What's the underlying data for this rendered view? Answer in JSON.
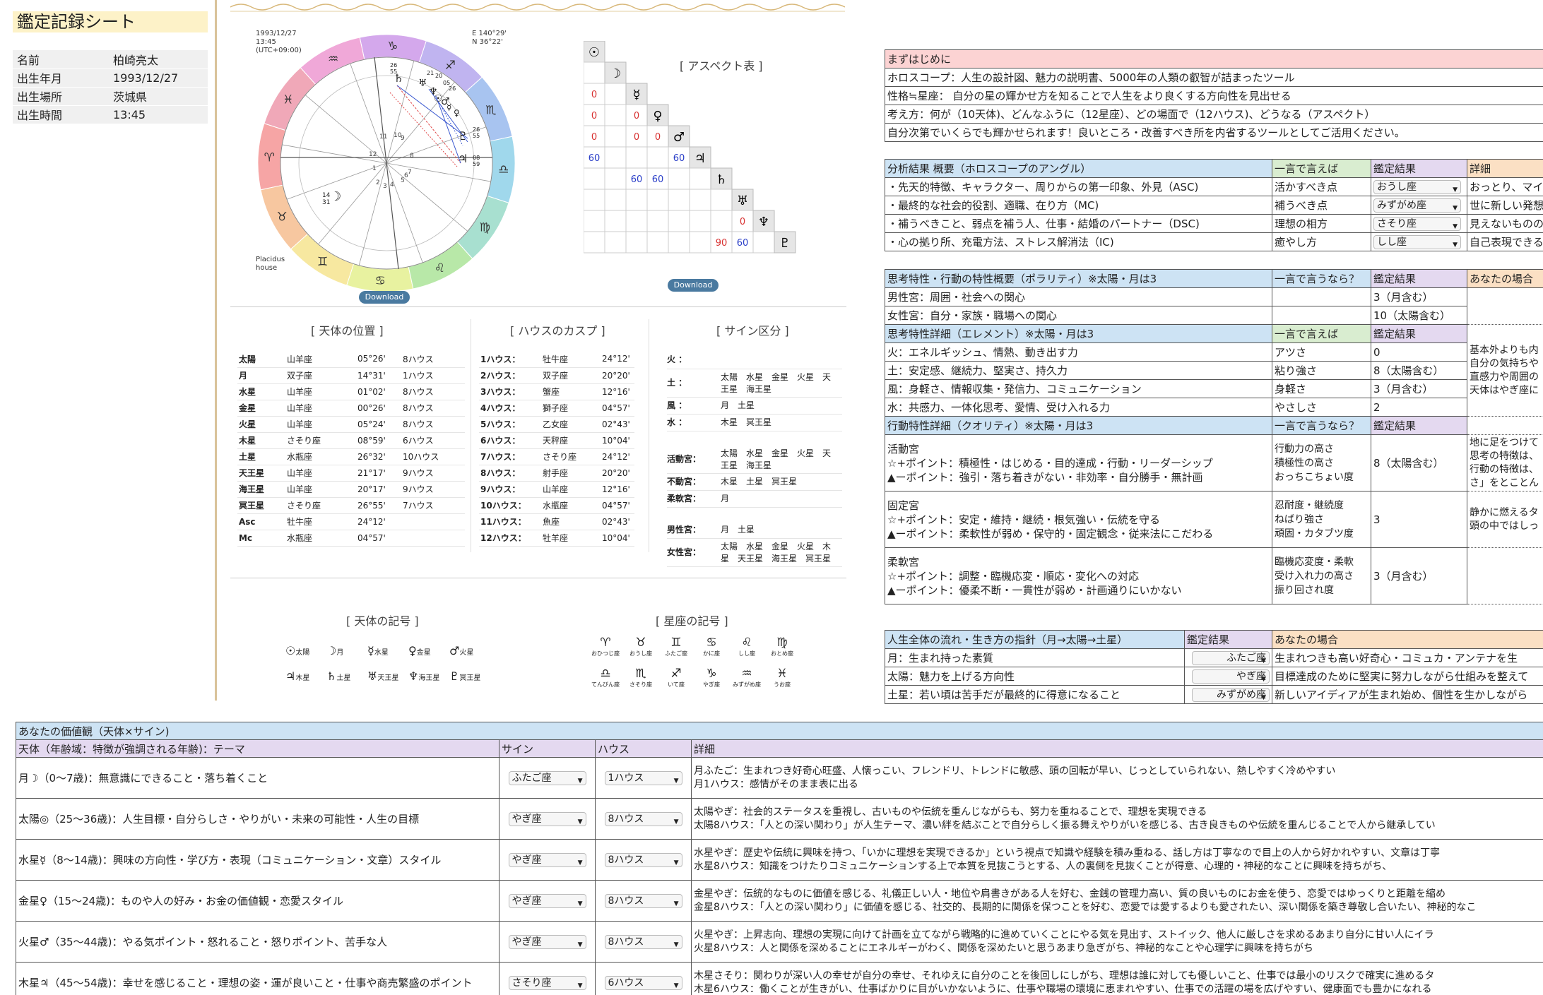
{
  "left": {
    "title": "鑑定記録シート",
    "rows": [
      {
        "k": "名前",
        "v": "柏崎亮太"
      },
      {
        "k": "出生年月",
        "v": "1993/12/27"
      },
      {
        "k": "出生場所",
        "v": "茨城県"
      },
      {
        "k": "出生時間",
        "v": "13:45"
      }
    ]
  },
  "chart": {
    "date": "1993/12/27",
    "time": "13:45",
    "tz": "(UTC+09:00)",
    "lon": "E 140°29'",
    "lat": "N 36°22'",
    "house_system_1": "Placidus",
    "house_system_2": "house",
    "download": "Download",
    "asc_deg": "14",
    "asc_min": "31",
    "mc_deg": "26",
    "mc_min": "55",
    "desc_deg": "08",
    "desc_min": "59"
  },
  "aspect": {
    "title": "[ アスペクト表 ]",
    "download": "Download",
    "planets": [
      "☉",
      "☽",
      "☿",
      "♀",
      "♂",
      "♃",
      "♄",
      "♅",
      "♆",
      "♇"
    ],
    "cells": [
      {
        "r": 2,
        "c": 0,
        "v": "0",
        "col": "red"
      },
      {
        "r": 3,
        "c": 0,
        "v": "0",
        "col": "red"
      },
      {
        "r": 3,
        "c": 2,
        "v": "0",
        "col": "red"
      },
      {
        "r": 4,
        "c": 0,
        "v": "0",
        "col": "red"
      },
      {
        "r": 4,
        "c": 2,
        "v": "0",
        "col": "red"
      },
      {
        "r": 4,
        "c": 3,
        "v": "0",
        "col": "red"
      },
      {
        "r": 5,
        "c": 0,
        "v": "60",
        "col": "blue"
      },
      {
        "r": 5,
        "c": 4,
        "v": "60",
        "col": "blue"
      },
      {
        "r": 6,
        "c": 2,
        "v": "60",
        "col": "blue"
      },
      {
        "r": 6,
        "c": 3,
        "v": "60",
        "col": "blue"
      },
      {
        "r": 8,
        "c": 7,
        "v": "0",
        "col": "red"
      },
      {
        "r": 9,
        "c": 6,
        "v": "90",
        "col": "red"
      },
      {
        "r": 9,
        "c": 7,
        "v": "60",
        "col": "blue"
      }
    ]
  },
  "planets": {
    "title": "[ 天体の位置 ]",
    "rows": [
      [
        "太陽",
        "山羊座",
        "05°26'",
        "8ハウス"
      ],
      [
        "月",
        "双子座",
        "14°31'",
        "1ハウス"
      ],
      [
        "水星",
        "山羊座",
        "01°02'",
        "8ハウス"
      ],
      [
        "金星",
        "山羊座",
        "00°26'",
        "8ハウス"
      ],
      [
        "火星",
        "山羊座",
        "05°24'",
        "8ハウス"
      ],
      [
        "木星",
        "さそり座",
        "08°59'",
        "6ハウス"
      ],
      [
        "土星",
        "水瓶座",
        "26°32'",
        "10ハウス"
      ],
      [
        "天王星",
        "山羊座",
        "21°17'",
        "9ハウス"
      ],
      [
        "海王星",
        "山羊座",
        "20°17'",
        "9ハウス"
      ],
      [
        "冥王星",
        "さそり座",
        "26°55'",
        "7ハウス"
      ],
      [
        "Asc",
        "牡牛座",
        "24°12'",
        ""
      ],
      [
        "Mc",
        "水瓶座",
        "04°57'",
        ""
      ]
    ]
  },
  "cusps": {
    "title": "[ ハウスのカスプ ]",
    "rows": [
      [
        "1ハウス：",
        "牡牛座",
        "24°12'"
      ],
      [
        "2ハウス：",
        "双子座",
        "20°20'"
      ],
      [
        "3ハウス：",
        "蟹座",
        "12°16'"
      ],
      [
        "4ハウス：",
        "獅子座",
        "04°57'"
      ],
      [
        "5ハウス：",
        "乙女座",
        "02°43'"
      ],
      [
        "6ハウス：",
        "天秤座",
        "10°04'"
      ],
      [
        "7ハウス：",
        "さそり座",
        "24°12'"
      ],
      [
        "8ハウス：",
        "射手座",
        "20°20'"
      ],
      [
        "9ハウス：",
        "山羊座",
        "12°16'"
      ],
      [
        "10ハウス：",
        "水瓶座",
        "04°57'"
      ],
      [
        "11ハウス：",
        "魚座",
        "02°43'"
      ],
      [
        "12ハウス：",
        "牡羊座",
        "10°04'"
      ]
    ]
  },
  "signs": {
    "title": "[ サイン区分 ]",
    "fire_k": "火 ：",
    "fire_v": "",
    "earth_k": "土 ：",
    "earth_v1": "太陽　水星　金星　火星　天",
    "earth_v2": "王星　海王星",
    "air_k": "風 ：",
    "air_v": "月　土星",
    "water_k": "水 ：",
    "water_v": "木星　冥王星",
    "card_k": "活動宮：",
    "card_v1": "太陽　水星　金星　火星　天",
    "card_v2": "王星　海王星",
    "fixed_k": "不動宮：",
    "fixed_v": "木星　土星　冥王星",
    "mut_k": "柔軟宮：",
    "mut_v": "月",
    "male_k": "男性宮：",
    "male_v": "月　土星",
    "fem_k": "女性宮：",
    "fem_v1": "太陽　水星　金星　火星　木",
    "fem_v2": "星　天王星　海王星　冥王星"
  },
  "legend_planets": {
    "title": "[ 天体の記号 ]",
    "items": [
      {
        "g": "☉",
        "n": "太陽"
      },
      {
        "g": "☽",
        "n": "月"
      },
      {
        "g": "☿",
        "n": "水星"
      },
      {
        "g": "♀",
        "n": "金星"
      },
      {
        "g": "♂",
        "n": "火星"
      },
      {
        "g": "♃",
        "n": "木星"
      },
      {
        "g": "♄",
        "n": "土星"
      },
      {
        "g": "♅",
        "n": "天王星"
      },
      {
        "g": "♆",
        "n": "海王星"
      },
      {
        "g": "♇",
        "n": "冥王星"
      }
    ]
  },
  "legend_signs": {
    "title": "[ 星座の記号 ]",
    "items": [
      {
        "g": "♈",
        "n": "おひつじ座"
      },
      {
        "g": "♉",
        "n": "おうし座"
      },
      {
        "g": "♊",
        "n": "ふたご座"
      },
      {
        "g": "♋",
        "n": "かに座"
      },
      {
        "g": "♌",
        "n": "しし座"
      },
      {
        "g": "♍",
        "n": "おとめ座"
      },
      {
        "g": "♎",
        "n": "てんびん座"
      },
      {
        "g": "♏",
        "n": "さそり座"
      },
      {
        "g": "♐",
        "n": "いて座"
      },
      {
        "g": "♑",
        "n": "やぎ座"
      },
      {
        "g": "♒",
        "n": "みずがめ座"
      },
      {
        "g": "♓",
        "n": "うお座"
      }
    ]
  },
  "intro": {
    "head": "まずはじめに",
    "rows": [
      "ホロスコープ：人生の設計図、魅力の説明書、5000年の人類の叡智が詰まったツール",
      "性格≒星座： 自分の星の輝かせ方を知ることで人生をより良くする方向性を見出せる",
      "考え方：何が（10天体)、どんなふうに（12星座）、どの場面で（12ハウス)、どうなる（アスペクト）",
      "自分次第でいくらでも輝かせられます！良いところ・改善すべき所を内省するツールとしてご活用ください。"
    ]
  },
  "angles": {
    "h1": "分析結果 概要（ホロスコープのアングル）",
    "h2": "一言で言えば",
    "h3": "鑑定結果",
    "h4": "詳細",
    "rows": [
      [
        "・先天的特徴、キャラクター、周りからの第一印象、外見（ASC)",
        "活かすべき点",
        "おうし座",
        "おっとり、マイ"
      ],
      [
        "・最終的な社会的役割、適職、在り方（MC)",
        "補うべき点",
        "みずがめ座",
        "世に新しい発想"
      ],
      [
        "・補うべきこと、弱点を補う人、仕事・結婚のパートナー（DSC)",
        "理想の相方",
        "さそり座",
        "見えないものの"
      ],
      [
        "・心の拠り所、充電方法、ストレス解消法（IC)",
        "癒やし方",
        "しし座",
        "自己表現できる"
      ]
    ]
  },
  "polarity": {
    "h1": "思考特性・行動の特性概要（ポラリティ）※太陽・月は3",
    "h2": "一言で言うなら？",
    "h3": "鑑定結果",
    "h4": "あなたの場合",
    "male": "男性宮：周囲・社会への関心",
    "male_r": "3（月含む）",
    "female": "女性宮：自分・家族・職場への関心",
    "female_r": "10（太陽含む）",
    "e_h1": "思考特性詳細（エレメント）※太陽・月は3",
    "e_h2": "一言で言えば",
    "e_h3": "鑑定結果",
    "elements": [
      [
        "火：エネルギッシュ、情熱、動き出す力",
        "アツさ",
        "0"
      ],
      [
        "土：安定感、継続力、堅実さ、持久力",
        "粘り強さ",
        "8（太陽含む）"
      ],
      [
        "風：身軽さ、情報収集・発信力、コミュニケーション",
        "身軽さ",
        "3（月含む）"
      ],
      [
        "水：共感力、一体化思考、愛情、受け入れる力",
        "やさしさ",
        "2"
      ]
    ],
    "note1": "基本外よりも内",
    "note2": "自分の気持ちや",
    "note3": "直感力や周囲の",
    "note4": "天体はやぎ座に",
    "q_h1": "行動特性詳細（クオリティ）※太陽・月は3",
    "q_h2": "一言で言うなら？",
    "q_h3": "鑑定結果",
    "card_t": "活動宮",
    "card_p": "☆+ポイント：積極性・はじめる・目的達成・行動・リーダーシップ",
    "card_m": "▲ーポイント：強引・落ち着きがない・非効率・自分勝手・無計画",
    "card_w1": "行動力の高さ",
    "card_w2": "積極性の高さ",
    "card_w3": "おっちこちょい度",
    "card_r": "8（太陽含む）",
    "card_n1": "地に足をつけて",
    "card_n2": "思考の特徴は、",
    "card_n3": "行動の特徴は、",
    "card_n4": "さ」をとことん",
    "fixed_t": "固定宮",
    "fixed_p": "☆+ポイント：安定・維持・継続・根気強い・伝統を守る",
    "fixed_m": "▲ーポイント：柔軟性が弱め・保守的・固定観念・従来法にこだわる",
    "fixed_w1": "忍耐度・継続度",
    "fixed_w2": "ねばり強さ",
    "fixed_w3": "頑固・カタブツ度",
    "fixed_r": "3",
    "fixed_n1": "静かに燃えるタ",
    "fixed_n2": "頭の中ではしっ",
    "mut_t": "柔軟宮",
    "mut_p": "☆+ポイント：調整・臨機応変・順応・変化への対応",
    "mut_m": "▲ーポイント：優柔不断・一貫性が弱め・計画通りにいかない",
    "mut_w1": "臨機応変度・柔軟",
    "mut_w2": "受け入れ力の高さ",
    "mut_w3": "振り回され度",
    "mut_r": "3（月含む）"
  },
  "flow": {
    "h1": "人生全体の流れ・生き方の指針（月→太陽→土星）",
    "h2": "鑑定結果",
    "h3": "あなたの場合",
    "rows": [
      [
        "月：生まれ持った素質",
        "ふたご座",
        "生まれつきも高い好奇心・コミュカ・アンテナを生"
      ],
      [
        "太陽：魅力を上げる方向性",
        "やぎ座",
        "目標達成のために堅実に努力しながら仕組みを整えて"
      ],
      [
        "土星：若い頃は苦手だが最終的に得意になること",
        "みずがめ座",
        "新しいアイディアが生まれ始め、個性を生かしながら"
      ]
    ]
  },
  "values": {
    "head": "あなたの価値観（天体×サイン)",
    "h1": "天体（年齢域：特徴が強調される年齢)：テーマ",
    "h2": "サイン",
    "h3": "ハウス",
    "h4": "詳細",
    "rows": [
      {
        "t": "月☽（0〜7歳)：無意識にできること・落ち着くこと",
        "s": "ふたご座",
        "h": "1ハウス",
        "d1": "月ふたご：生まれつき好奇心旺盛、人懐っこい、フレンドリ、トレンドに敏感、頭の回転が早い、じっとしていられない、熱しやすく冷めやすい",
        "d2": "月1ハウス：感情がそのまま表に出る"
      },
      {
        "t": "太陽◎（25〜36歳)：人生目標・自分らしさ・やりがい・未来の可能性・人生の目標",
        "s": "やぎ座",
        "h": "8ハウス",
        "d1": "太陽やぎ：社会的ステータスを重視し、古いものや伝統を重んじながらも、努力を重ねることで、理想を実現できる",
        "d2": "太陽8ハウス：「人との深い関わり」が人生テーマ、濃い絆を結ぶことで自分らしく振る舞えやりがいを感じる、古き良きものや伝統を重んじることで人から継承してい"
      },
      {
        "t": "水星☿（8〜14歳)：興味の方向性・学び方・表現（コミュニケーション・文章）スタイル",
        "s": "やぎ座",
        "h": "8ハウス",
        "d1": "水星やぎ：歴史や伝統に興味を持つ、「いかに理想を実現できるか」という視点で知識や経験を積み重ねる、話し方は丁寧なので目上の人から好かれやすい、文章は丁寧",
        "d2": "水星8ハウス：知識をつけたりコミュニケーションする上で本質を見抜こうとする、人の裏側を見抜くことが得意、心理的・神秘的なことに興味を持ちがち、"
      },
      {
        "t": "金星♀（15〜24歳)：ものや人の好み・お金の価値観・恋愛スタイル",
        "s": "やぎ座",
        "h": "8ハウス",
        "d1": "金星やぎ：伝統的なものに価値を感じる、礼儀正しい人・地位や肩書きがある人を好む、金銭の管理力高い、質の良いものにお金を使う、恋愛ではゆっくりと距離を縮め",
        "d2": "金星8ハウス：「人との深い関わり」に価値を感じる、社交的、長期的に関係を保つことを好む、恋愛では愛するよりも愛されたい、深い関係を築き尊敬し合いたい、神秘的なこ"
      },
      {
        "t": "火星♂（35〜44歳)：やる気ポイント・怒れること・怒りポイント、苦手な人",
        "s": "やぎ座",
        "h": "8ハウス",
        "d1": "火星やぎ：上昇志向、理想の実現に向けて計画を立てながら戦略的に進めていくことにやる気を見出す、ストイック、他人に厳しさを求めるあまり自分に甘い人にイラ",
        "d2": "火星8ハウス：人と関係を深めることにエネルギーがわく、関係を深めたいと思うあまり急ぎがち、神秘的なことや心理学に興味を持ちがち"
      },
      {
        "t": "木星♃（45〜54歳)：幸せを感じること・理想の姿・運が良いこと・仕事や商売繁盛のポイント",
        "s": "さそり座",
        "h": "6ハウス",
        "d1": "木星さそり：関わりが深い人の幸せが自分の幸せ、それゆえに自分のことを後回しにしがち、理想は誰に対しても優しいこと、仕事では最小のリスクで確実に進めるタ",
        "d2": "木星6ハウス：働くことが生きがい、仕事ばかりに目がいかないように、仕事や職場の環境に恵まれやすい、仕事での活躍の場を広げやすい、健康面でも豊かになれる"
      }
    ]
  }
}
